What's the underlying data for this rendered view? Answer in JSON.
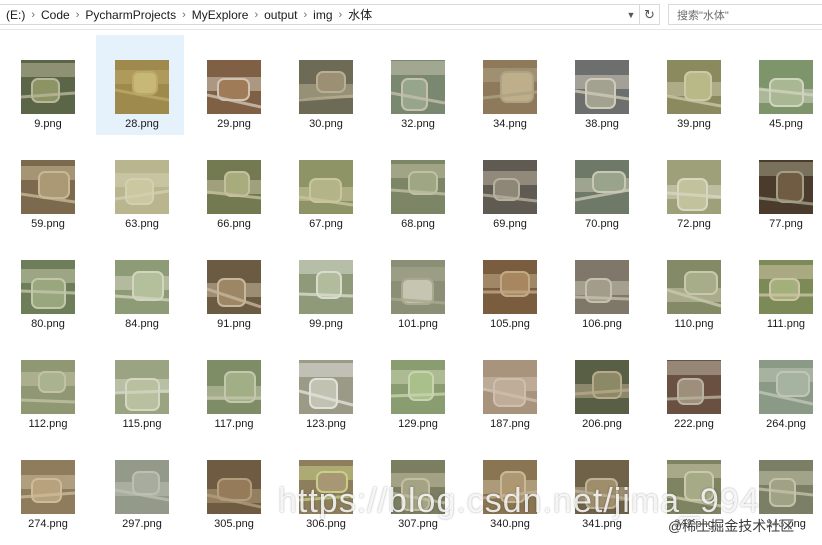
{
  "address_bar": {
    "crumbs": [
      "(E:)",
      "Code",
      "PycharmProjects",
      "MyExplore",
      "output",
      "img",
      "水体"
    ],
    "search_placeholder": "搜索\"水体\""
  },
  "files": [
    {
      "name": "9.png",
      "colors": [
        "#5b6547",
        "#8c9466",
        "#b9b79a"
      ]
    },
    {
      "name": "28.png",
      "colors": [
        "#9f8a4e",
        "#c7b878",
        "#bca867"
      ],
      "selected": true
    },
    {
      "name": "29.png",
      "colors": [
        "#7f6045",
        "#a07b58",
        "#cfc4b4"
      ]
    },
    {
      "name": "30.png",
      "colors": [
        "#6d6a55",
        "#9b8f74",
        "#b8ae94"
      ]
    },
    {
      "name": "32.png",
      "colors": [
        "#7a8871",
        "#98a58d",
        "#c3c1ad"
      ]
    },
    {
      "name": "34.png",
      "colors": [
        "#8e7a5a",
        "#bfae8a",
        "#aca385"
      ]
    },
    {
      "name": "38.png",
      "colors": [
        "#6d6f6e",
        "#a3a290",
        "#d0cbb9"
      ]
    },
    {
      "name": "39.png",
      "colors": [
        "#8a8a5e",
        "#b9b987",
        "#ccc8aa"
      ]
    },
    {
      "name": "45.png",
      "colors": [
        "#7e946b",
        "#a9b892",
        "#cfd4be"
      ]
    },
    {
      "name": "59.png",
      "colors": [
        "#7d6a4e",
        "#ab9875",
        "#c6b894"
      ]
    },
    {
      "name": "63.png",
      "colors": [
        "#b8b58f",
        "#cac7a1",
        "#d3cfb1"
      ]
    },
    {
      "name": "66.png",
      "colors": [
        "#737a52",
        "#a8ab7c",
        "#c4bf9f"
      ]
    },
    {
      "name": "67.png",
      "colors": [
        "#8e9466",
        "#b3b588",
        "#c8c59f"
      ]
    },
    {
      "name": "68.png",
      "colors": [
        "#7c8565",
        "#9fa683",
        "#bfc0a2"
      ]
    },
    {
      "name": "69.png",
      "colors": [
        "#5f5a52",
        "#8c8777",
        "#b8b09e"
      ]
    },
    {
      "name": "70.png",
      "colors": [
        "#6e7a67",
        "#9aa48d",
        "#c9c7b5"
      ]
    },
    {
      "name": "72.png",
      "colors": [
        "#9ea07a",
        "#c2c39d",
        "#d8d6c0"
      ]
    },
    {
      "name": "77.png",
      "colors": [
        "#4a3b2c",
        "#6f5c43",
        "#a29f86"
      ]
    },
    {
      "name": "80.png",
      "colors": [
        "#6f7e5a",
        "#98a77d",
        "#c3c6a8"
      ]
    },
    {
      "name": "84.png",
      "colors": [
        "#8d9b76",
        "#b4c09c",
        "#d3d4bf"
      ]
    },
    {
      "name": "91.png",
      "colors": [
        "#6b5b43",
        "#9c8666",
        "#c6b79b"
      ]
    },
    {
      "name": "99.png",
      "colors": [
        "#8f9a7a",
        "#b2bc9d",
        "#d9dccd"
      ]
    },
    {
      "name": "101.png",
      "colors": [
        "#8b8f76",
        "#c4c6b2",
        "#a9a98f"
      ]
    },
    {
      "name": "105.png",
      "colors": [
        "#7a5d3f",
        "#a88660",
        "#c0aa86"
      ]
    },
    {
      "name": "106.png",
      "colors": [
        "#7f786a",
        "#a29c8a",
        "#c5bfad"
      ]
    },
    {
      "name": "110.png",
      "colors": [
        "#848a66",
        "#a7ad88",
        "#c9c8ab"
      ]
    },
    {
      "name": "111.png",
      "colors": [
        "#7c8a58",
        "#a4b07b",
        "#cdc4a6"
      ]
    },
    {
      "name": "112.png",
      "colors": [
        "#8f9873",
        "#aab38d",
        "#c2c2a3"
      ]
    },
    {
      "name": "115.png",
      "colors": [
        "#9aa482",
        "#b8c09f",
        "#d4d6c2"
      ]
    },
    {
      "name": "117.png",
      "colors": [
        "#7f8d66",
        "#a2ae86",
        "#c3c7ab"
      ]
    },
    {
      "name": "123.png",
      "colors": [
        "#9a9a86",
        "#c2c2b2",
        "#e0e2da"
      ]
    },
    {
      "name": "129.png",
      "colors": [
        "#8a9d71",
        "#a9c08a",
        "#c9d3b1"
      ]
    },
    {
      "name": "187.png",
      "colors": [
        "#a8937c",
        "#c0ad97",
        "#cdbfae"
      ]
    },
    {
      "name": "206.png",
      "colors": [
        "#585f45",
        "#8c8a66",
        "#b8a98a"
      ]
    },
    {
      "name": "222.png",
      "colors": [
        "#6a5040",
        "#9d8f7a",
        "#b9b2a0"
      ]
    },
    {
      "name": "264.png",
      "colors": [
        "#8a9a86",
        "#a5b3a0",
        "#c0c6b5"
      ]
    },
    {
      "name": "274.png",
      "colors": [
        "#8f7c5c",
        "#b7a27d",
        "#cbbb9b"
      ]
    },
    {
      "name": "297.png",
      "colors": [
        "#939a8a",
        "#a7ad9e",
        "#bcbfb1"
      ]
    },
    {
      "name": "305.png",
      "colors": [
        "#6f5b42",
        "#957b5a",
        "#b29d7c"
      ]
    },
    {
      "name": "306.png",
      "colors": [
        "#8e7f5c",
        "#a89775",
        "#c7d087"
      ]
    },
    {
      "name": "307.png",
      "colors": [
        "#7c7e62",
        "#a4a484",
        "#c4bfa2"
      ]
    },
    {
      "name": "340.png",
      "colors": [
        "#8a7552",
        "#ad9872",
        "#c9b898"
      ]
    },
    {
      "name": "341.png",
      "colors": [
        "#6f6248",
        "#9e8e6b",
        "#beb296"
      ]
    },
    {
      "name": "342.png",
      "colors": [
        "#7e8462",
        "#a6aa87",
        "#c9c8aa"
      ]
    },
    {
      "name": "343.png",
      "colors": [
        "#7a7f66",
        "#a0a286",
        "#c3c2a8"
      ]
    }
  ],
  "watermark": {
    "text": "https://blog.csdn.net/jima_994",
    "badge": "@稀土掘金技术社区"
  }
}
